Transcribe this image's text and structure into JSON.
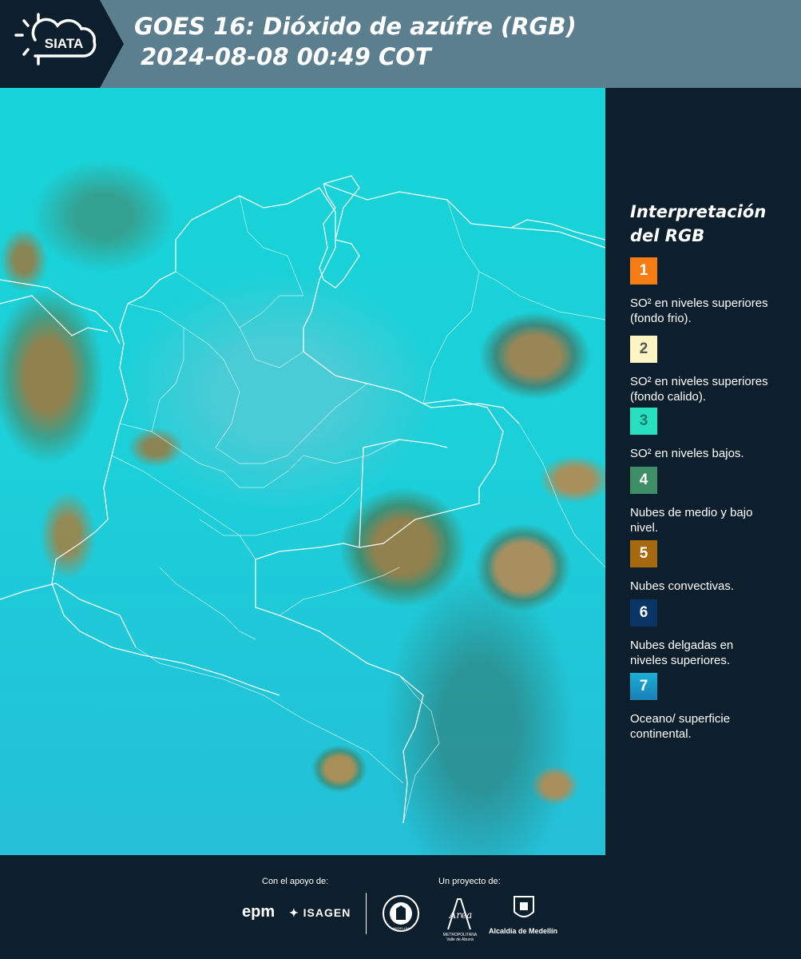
{
  "header": {
    "logo_text": "SIATA",
    "title_line1": "GOES 16: Dióxido de azúfre (RGB)",
    "title_line2": "2024-08-08 00:49 COT"
  },
  "legend": {
    "title_line1": "Interpretación",
    "title_line2": "del RGB",
    "items": [
      {
        "num": "1",
        "color": "#f57c14",
        "text_color": "#ffffff",
        "label": "SO² en niveles superiores (fondo frio)."
      },
      {
        "num": "2",
        "color": "#fff5c4",
        "text_color": "#555555",
        "label": "SO² en niveles superiores (fondo calido)."
      },
      {
        "num": "3",
        "color": "#27e0c2",
        "text_color": "#1f7a6a",
        "label": "SO² en niveles bajos."
      },
      {
        "num": "4",
        "color": "#3e8f68",
        "text_color": "#ffffff",
        "label": "Nubes de medio y bajo nivel."
      },
      {
        "num": "5",
        "color": "#a6690f",
        "text_color": "#ffffff",
        "label": "Nubes convectivas."
      },
      {
        "num": "6",
        "color": "#0c3567",
        "text_color": "#ffffff",
        "label": "Nubes delgadas en niveles superiores."
      },
      {
        "num": "7",
        "color": "#1a95c5",
        "text_color": "#ffffff",
        "label": "Oceano/ superficie continental."
      }
    ]
  },
  "footer": {
    "support_label": "Con el apoyo de:",
    "project_label": "Un proyecto de:",
    "sponsor1": "epm",
    "sponsor2": "ISAGEN",
    "seal_text": "MEDELLÍN",
    "area_text": "METROPOLITANA Valle de Aburrá",
    "area_script": "Área",
    "alcaldia": "Alcaldía de Medellín"
  }
}
